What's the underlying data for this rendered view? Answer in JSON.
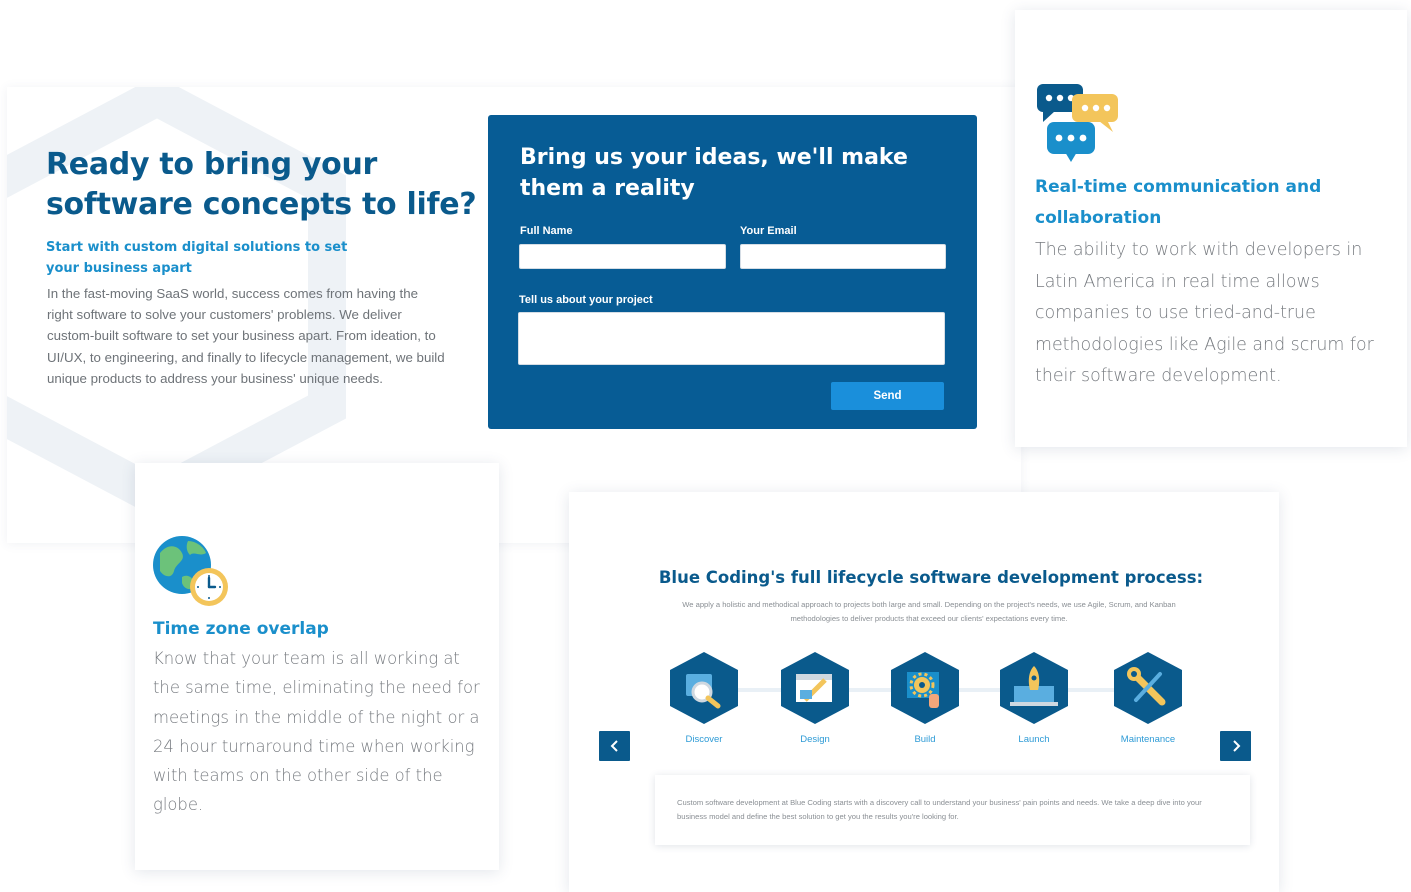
{
  "hero": {
    "title": "Ready to bring your software concepts to life?",
    "subtitle": "Start with custom digital solutions to set your business apart",
    "body": "In the fast-moving SaaS world, success comes from having the right software to solve your customers' problems. We deliver custom-built software to set your business apart. From ideation, to UI/UX, to engineering, and finally to lifecycle management, we build unique products to address your business' unique needs."
  },
  "contact_form": {
    "title": "Bring us your ideas, we'll make them a reality",
    "full_name_label": "Full Name",
    "full_name_value": "",
    "email_label": "Your Email",
    "email_value": "",
    "project_label": "Tell us about your project",
    "project_value": "",
    "send_label": "Send"
  },
  "realtime_card": {
    "icon": "chat-bubbles-icon",
    "title": "Real-time communication and collaboration",
    "text": "The ability to work with developers in Latin America in real time allows companies to use tried-and-true methodologies like Agile and scrum for their software development."
  },
  "timezone_card": {
    "icon": "globe-clock-icon",
    "title": "Time zone overlap",
    "text": "Know that your team is all working at the same time, eliminating the need for meetings in the middle of the night or a 24 hour turnaround time when working with teams on the other side of the globe."
  },
  "process": {
    "title": "Blue Coding's full lifecycle software development process:",
    "description": "We apply a holistic and methodical approach to projects both large and small. Depending on the project's needs, we use Agile, Scrum, and Kanban methodologies to deliver products that exceed our clients' expectations every time.",
    "steps": [
      {
        "label": "Discover",
        "icon": "magnifier-icon"
      },
      {
        "label": "Design",
        "icon": "design-pencil-icon"
      },
      {
        "label": "Build",
        "icon": "gear-build-icon"
      },
      {
        "label": "Launch",
        "icon": "rocket-laptop-icon"
      },
      {
        "label": "Maintenance",
        "icon": "wrench-icon"
      }
    ],
    "prev_icon": "chevron-left-icon",
    "next_icon": "chevron-right-icon",
    "detail": "Custom software development at Blue Coding starts with a discovery call to understand your business' pain points and needs. We take a deep dive into your business model and define the best solution to get you the results you're looking for."
  },
  "colors": {
    "brand_dark": "#0a5a8c",
    "brand_light": "#1a8fcb",
    "form_bg": "#075c95",
    "button": "#1a8fdb",
    "accent_yellow": "#f3c55b"
  }
}
